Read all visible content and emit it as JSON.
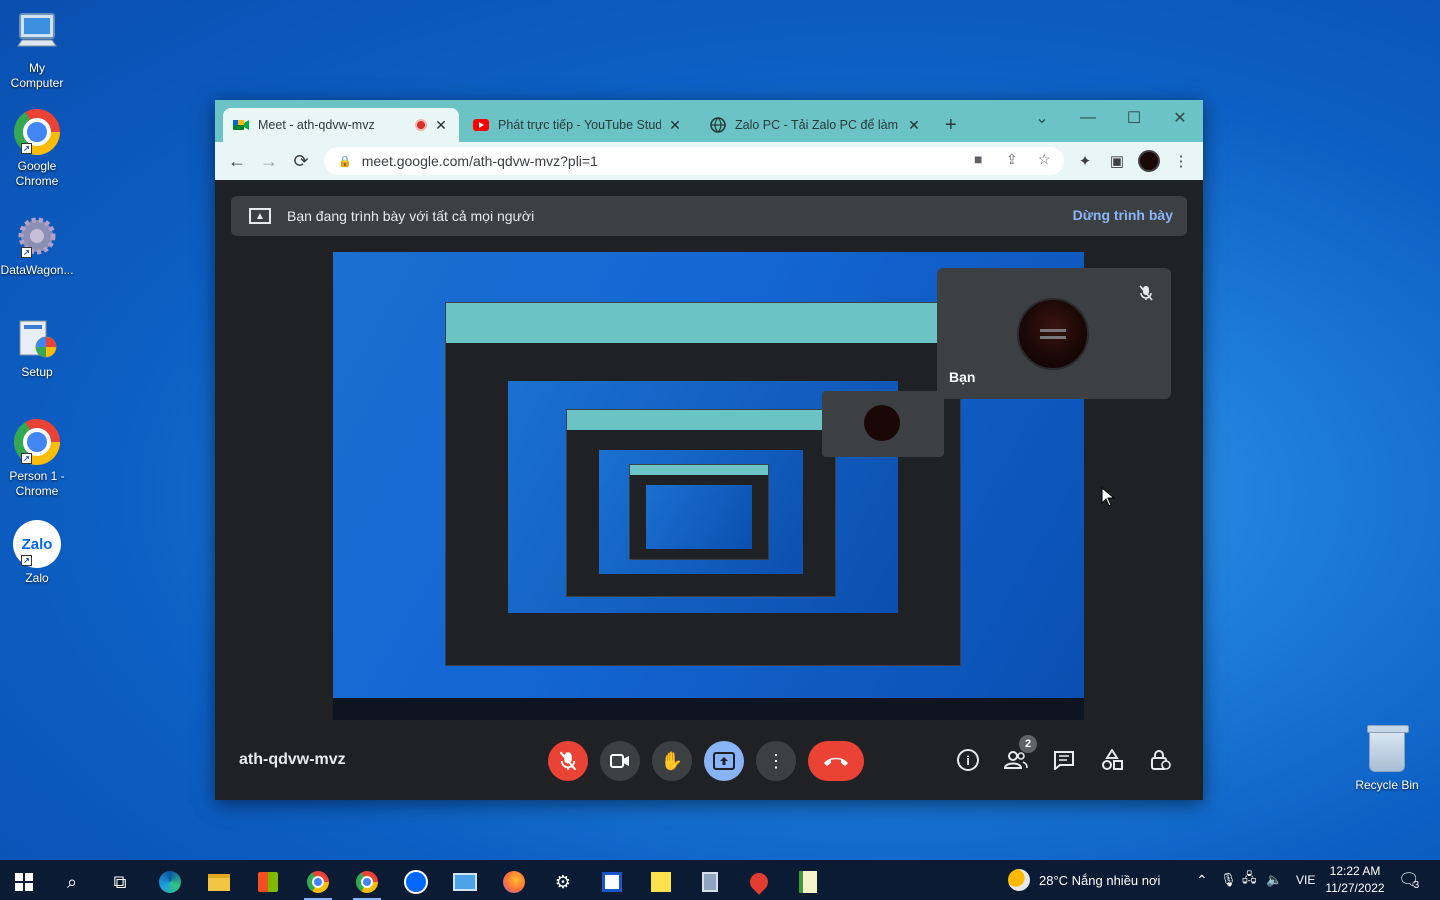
{
  "desktop": {
    "icons": [
      {
        "label": "My Computer"
      },
      {
        "label": "Google Chrome"
      },
      {
        "label": "DataWagon..."
      },
      {
        "label": "Setup"
      },
      {
        "label": "Person 1 - Chrome"
      },
      {
        "label": "Zalo"
      }
    ],
    "recycle_bin": "Recycle Bin",
    "zalo_logo_text": "Zalo"
  },
  "browser": {
    "tabs": [
      {
        "title": "Meet - ath-qdvw-mvz",
        "icon": "google-meet-icon",
        "recording": true
      },
      {
        "title": "Phát trực tiếp - YouTube Studio",
        "icon": "youtube-icon"
      },
      {
        "title": "Zalo PC - Tải Zalo PC để làm việ",
        "icon": "globe-icon"
      }
    ],
    "close_symbol": "✕",
    "new_tab_symbol": "+",
    "url": "meet.google.com/ath-qdvw-mvz?pli=1"
  },
  "meet": {
    "presenting_banner": "Bạn đang trình bày với tất cả mọi người",
    "stop_presenting": "Dừng trình bày",
    "self_tile_name": "Bạn",
    "meeting_code": "ath-qdvw-mvz",
    "participants_count": "2",
    "accent_red": "#ea4335",
    "accent_blue": "#8ab4f8"
  },
  "taskbar": {
    "weather": "28°C  Nắng nhiều nơi",
    "language": "VIE",
    "time": "12:22 AM",
    "date": "11/27/2022",
    "notification_count": "3"
  }
}
